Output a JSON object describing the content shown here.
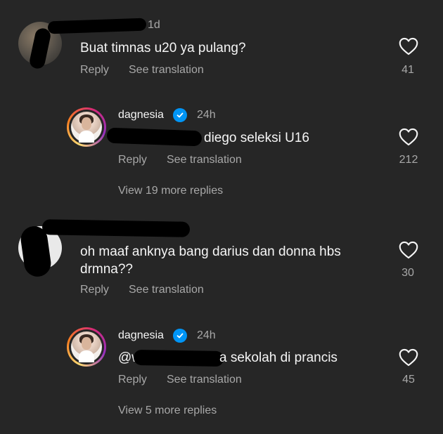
{
  "comments": [
    {
      "time": "1d",
      "text": "Buat timnas u20 ya pulang?",
      "reply_label": "Reply",
      "translate_label": "See translation",
      "likes": "41",
      "replies": [
        {
          "username": "dagnesia",
          "time": "24h",
          "text": "diego seleksi U16",
          "reply_label": "Reply",
          "translate_label": "See translation",
          "likes": "212"
        }
      ],
      "more_replies": "View 19 more replies"
    },
    {
      "text_line1": "oh maaf anknya bang darius dan donna hbs",
      "text_line2": "drmna??",
      "reply_label": "Reply",
      "translate_label": "See translation",
      "likes": "30",
      "replies": [
        {
          "username": "dagnesia",
          "time": "24h",
          "mention_prefix": "@w",
          "text": "a sekolah di prancis",
          "reply_label": "Reply",
          "translate_label": "See translation",
          "likes": "45"
        }
      ],
      "more_replies": "View 5 more replies"
    }
  ],
  "icons": {
    "like": "heart-outline-icon",
    "verified": "verified-badge-icon"
  },
  "colors": {
    "background": "#262626",
    "verified": "#0095f6",
    "secondary_text": "#a8a8a8"
  }
}
